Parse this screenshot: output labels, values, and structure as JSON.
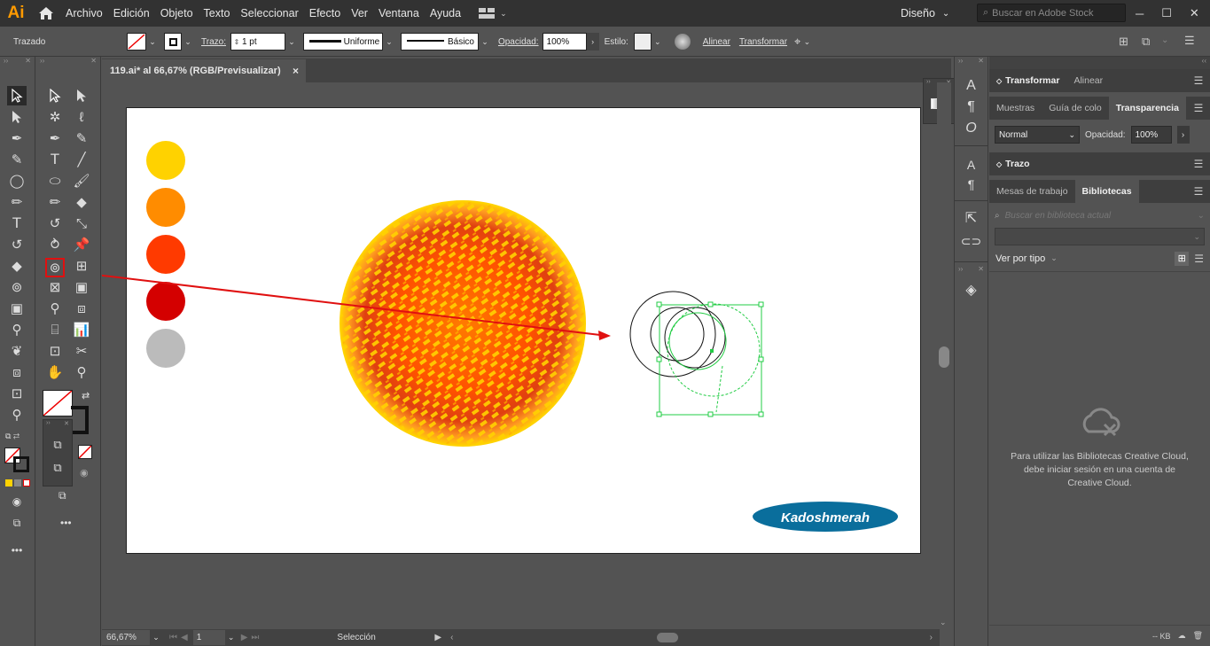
{
  "app": {
    "logo": "Ai"
  },
  "menu": [
    "Archivo",
    "Edición",
    "Objeto",
    "Texto",
    "Seleccionar",
    "Efecto",
    "Ver",
    "Ventana",
    "Ayuda"
  ],
  "workspace": {
    "label": "Diseño"
  },
  "stock_search": {
    "placeholder": "Buscar en Adobe Stock"
  },
  "control": {
    "selection_label": "Trazado",
    "stroke_label": "Trazo:",
    "stroke_weight": "1 pt",
    "profile": "Uniforme",
    "brush": "Básico",
    "opacity_label": "Opacidad:",
    "opacity_value": "100%",
    "style_label": "Estilo:",
    "align_label": "Alinear",
    "transform_label": "Transformar"
  },
  "document": {
    "tab_title": "119.ai* al 66,67% (RGB/Previsualizar)",
    "close": "×"
  },
  "artwork": {
    "swatches": [
      "#ffd200",
      "#ff8c00",
      "#ff3a00",
      "#d40000",
      "#bbbbbb"
    ],
    "logo_text": "Kadoshmerah",
    "logo_color": "#0a6e9c",
    "arrow_color": "#e01010"
  },
  "status": {
    "zoom": "66,67%",
    "page": "1",
    "tool_name": "Selección"
  },
  "panels": {
    "transform_tab": "Transformar",
    "align_tab": "Alinear",
    "swatches_tab": "Muestras",
    "color_guide_tab": "Guía de colo",
    "transparency_tab": "Transparencia",
    "blend_mode": "Normal",
    "opacity_label": "Opacidad:",
    "opacity_value": "100%",
    "stroke_tab": "Trazo",
    "artboards_tab": "Mesas de trabajo",
    "libraries_tab": "Bibliotecas",
    "library_search_placeholder": "Buscar en biblioteca actual",
    "view_by": "Ver por tipo",
    "libraries_message": "Para utilizar las Bibliotecas Creative Cloud, debe iniciar sesión en una cuenta de Creative Cloud.",
    "kb_label": "-- KB"
  },
  "colors": {
    "ui_dark": "#323232",
    "ui_mid": "#535353",
    "highlight_box": "#e01010",
    "selection_green": "#22cc44"
  }
}
